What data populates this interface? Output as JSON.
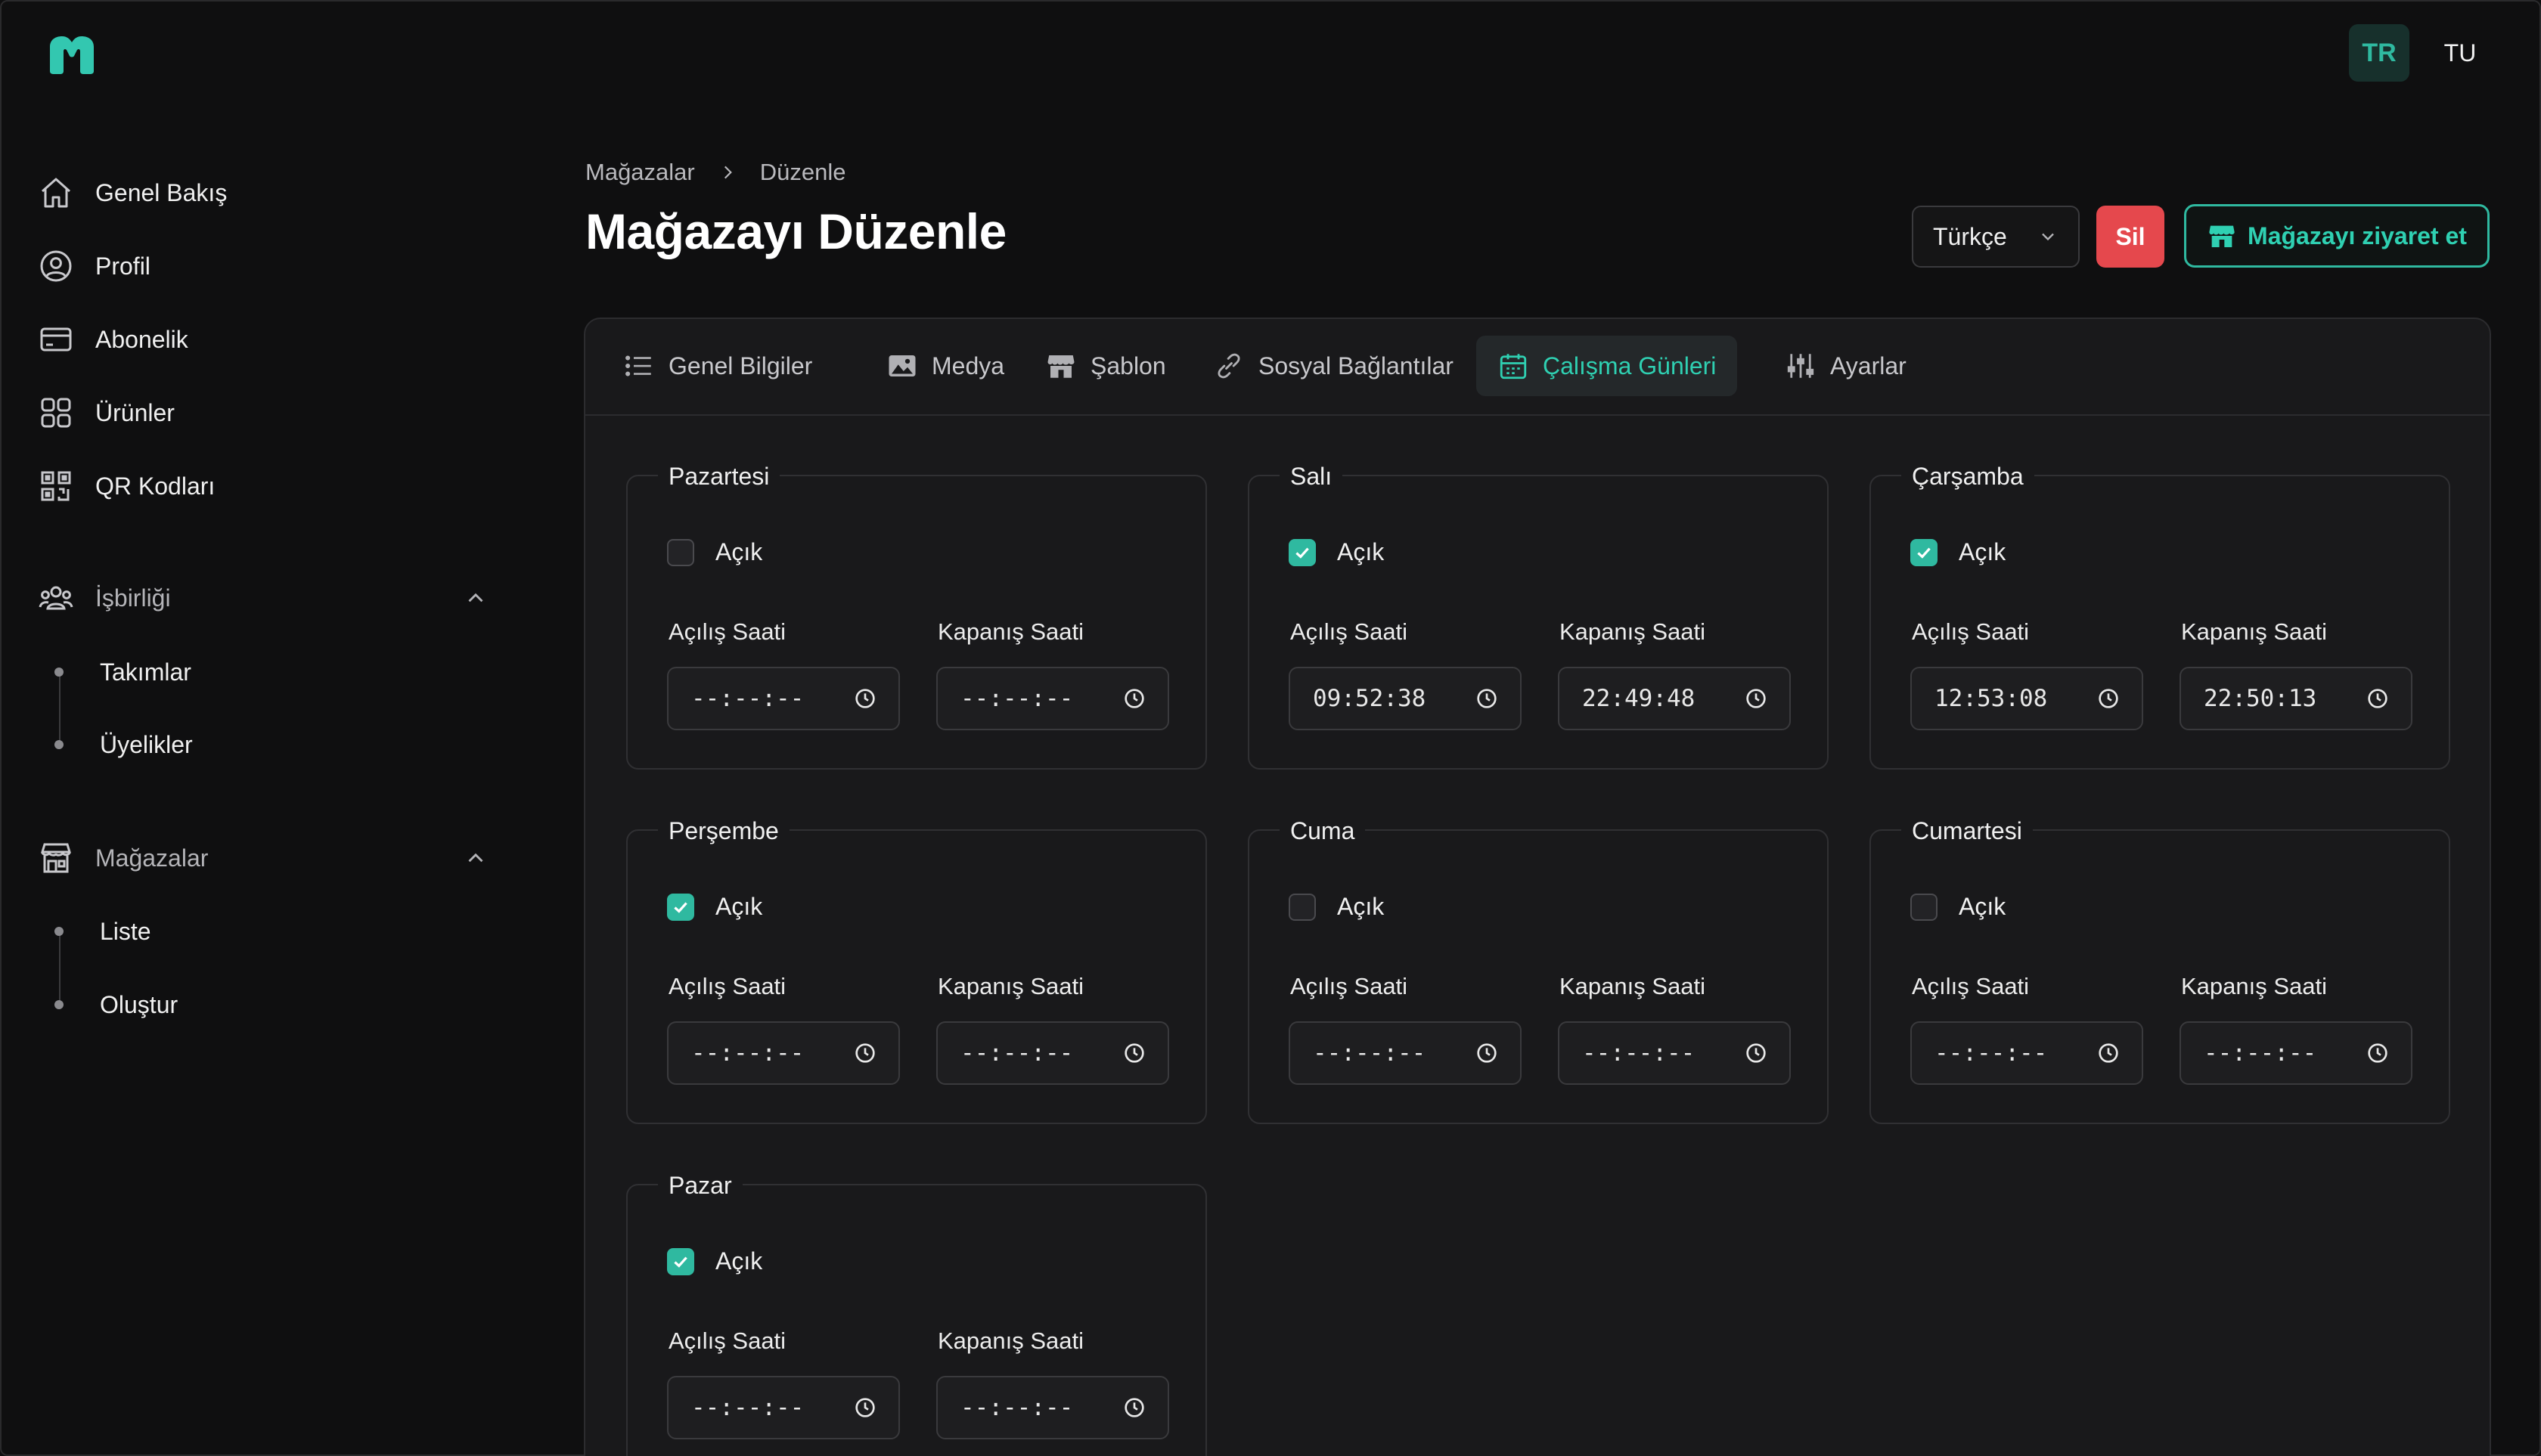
{
  "header": {
    "language_badge": "TR",
    "user_initials": "TU",
    "colors": {
      "accent": "#2fb9a0",
      "danger": "#e5484d",
      "background": "#0f0f10",
      "card": "#19191b"
    }
  },
  "sidebar": {
    "items": [
      {
        "label": "Genel Bakış",
        "icon": "home-icon"
      },
      {
        "label": "Profil",
        "icon": "user-circle-icon"
      },
      {
        "label": "Abonelik",
        "icon": "credit-card-icon"
      },
      {
        "label": "Ürünler",
        "icon": "grid-icon"
      },
      {
        "label": "QR Kodları",
        "icon": "qr-code-icon"
      }
    ],
    "sections": [
      {
        "label": "İşbirliği",
        "icon": "users-group-icon",
        "children": [
          "Takımlar",
          "Üyelikler"
        ]
      },
      {
        "label": "Mağazalar",
        "icon": "store-icon",
        "children": [
          "Liste",
          "Oluştur"
        ]
      }
    ]
  },
  "page": {
    "breadcrumb": [
      "Mağazalar",
      "Düzenle"
    ],
    "title": "Mağazayı Düzenle",
    "language_select": "Türkçe",
    "delete_label": "Sil",
    "visit_label": "Mağazayı ziyaret et"
  },
  "tabs": [
    {
      "label": "Genel Bilgiler",
      "icon": "list-icon",
      "active": false
    },
    {
      "label": "Medya",
      "icon": "image-icon",
      "active": false
    },
    {
      "label": "Şablon",
      "icon": "storefront-icon",
      "active": false
    },
    {
      "label": "Sosyal Bağlantılar",
      "icon": "link-icon",
      "active": false
    },
    {
      "label": "Çalışma Günleri",
      "icon": "calendar-icon",
      "active": true
    },
    {
      "label": "Ayarlar",
      "icon": "sliders-icon",
      "active": false
    }
  ],
  "labels": {
    "open": "Açık",
    "opening": "Açılış Saati",
    "closing": "Kapanış Saati"
  },
  "days": [
    {
      "name": "Pazartesi",
      "open": false,
      "opening": "--:--:--",
      "closing": "--:--:--"
    },
    {
      "name": "Salı",
      "open": true,
      "opening": "09:52:38",
      "closing": "22:49:48"
    },
    {
      "name": "Çarşamba",
      "open": true,
      "opening": "12:53:08",
      "closing": "22:50:13"
    },
    {
      "name": "Perşembe",
      "open": true,
      "opening": "--:--:--",
      "closing": "--:--:--"
    },
    {
      "name": "Cuma",
      "open": false,
      "opening": "--:--:--",
      "closing": "--:--:--"
    },
    {
      "name": "Cumartesi",
      "open": false,
      "opening": "--:--:--",
      "closing": "--:--:--"
    },
    {
      "name": "Pazar",
      "open": true,
      "opening": "--:--:--",
      "closing": "--:--:--"
    }
  ]
}
